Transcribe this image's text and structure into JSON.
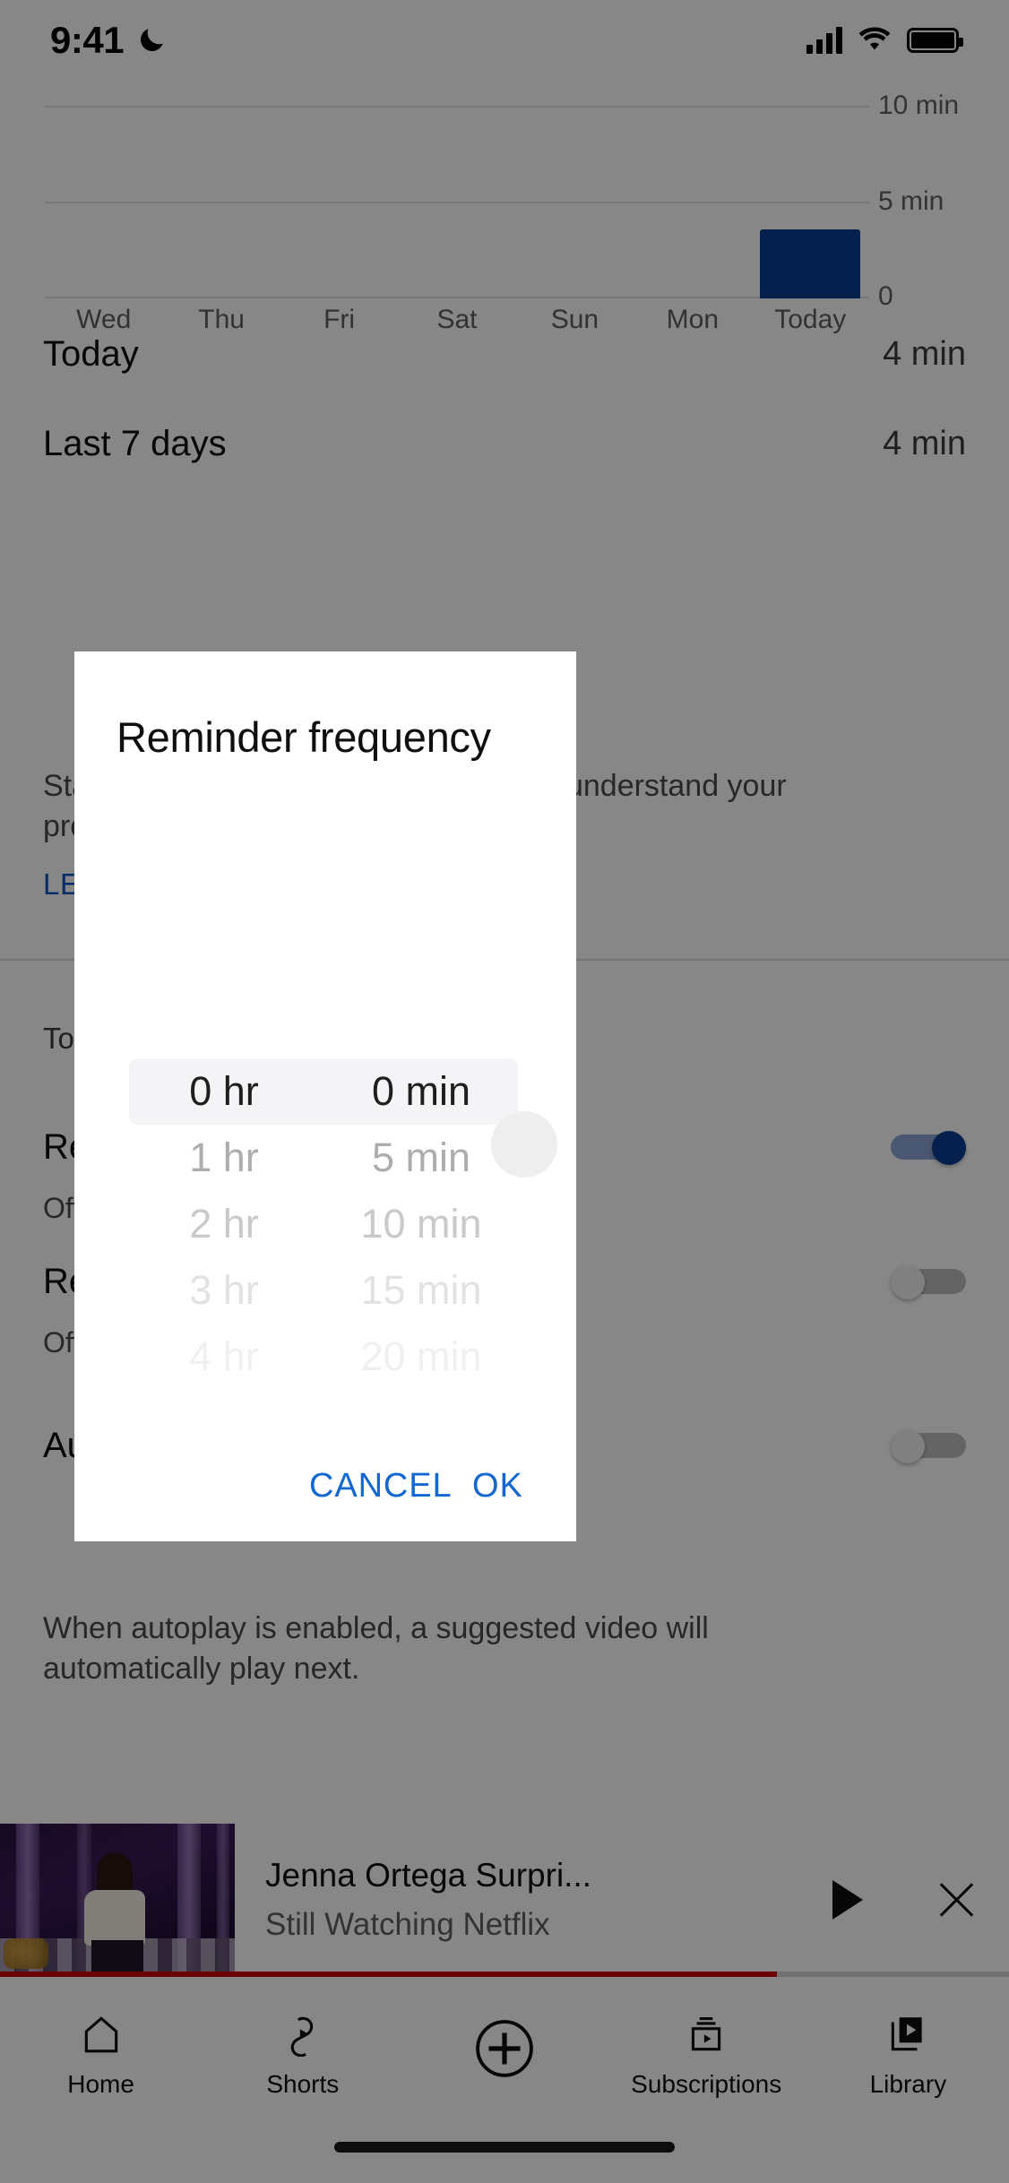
{
  "status_bar": {
    "time": "9:41",
    "dnd_icon": "crescent-moon-icon",
    "signal_icon": "cellular-signal-icon",
    "wifi_icon": "wifi-icon",
    "battery_icon": "battery-full-icon"
  },
  "chart_data": {
    "type": "bar",
    "title": "",
    "categories": [
      "Wed",
      "Thu",
      "Fri",
      "Sat",
      "Sun",
      "Mon",
      "Today"
    ],
    "values": [
      0,
      0,
      0,
      0,
      0,
      0,
      4
    ],
    "xlabel": "",
    "ylabel": "",
    "ylim": [
      0,
      11
    ],
    "ytick_labels": [
      "10 min",
      "5 min",
      "0"
    ],
    "ytick_values": [
      10,
      5,
      0
    ],
    "grid": true,
    "legend": "none",
    "bar_color": "#0b3d91",
    "unit": "min"
  },
  "stats": {
    "today_label": "Today",
    "today_value": "4 min",
    "last7_label": "Last 7 days",
    "last7_value": "4 min",
    "description_line1": "Stats on your watch time can help you understand your",
    "description_line2": "productivity and habits.",
    "learn_more": "LEARN MORE"
  },
  "tools": {
    "section_label": "Tools",
    "items": [
      {
        "title": "Remind me to take a break",
        "subtitle": "Off",
        "toggle": "on"
      },
      {
        "title": "Remind me when it's bedtime",
        "subtitle": "Off",
        "toggle": "off"
      }
    ],
    "autoplay": {
      "title": "Autoplay on mobile/tablet",
      "toggle": "off",
      "description_line1": "When autoplay is enabled, a suggested video will",
      "description_line2": "automatically play next."
    }
  },
  "dialog": {
    "title": "Reminder frequency",
    "hours": [
      {
        "label": "0 hr",
        "state": "selected"
      },
      {
        "label": "1 hr",
        "state": "o1"
      },
      {
        "label": "2 hr",
        "state": "o2"
      },
      {
        "label": "3 hr",
        "state": "o3"
      },
      {
        "label": "4 hr",
        "state": "o4"
      }
    ],
    "minutes": [
      {
        "label": "0 min",
        "state": "selected"
      },
      {
        "label": "5 min",
        "state": "o1"
      },
      {
        "label": "10 min",
        "state": "o2"
      },
      {
        "label": "15 min",
        "state": "o3"
      },
      {
        "label": "20 min",
        "state": "o4"
      }
    ],
    "cancel_label": "CANCEL",
    "ok_label": "OK",
    "accent_color": "#1367d0"
  },
  "miniplayer": {
    "title": "Jenna Ortega Surpri...",
    "channel": "Still Watching Netflix",
    "play_icon": "play-icon",
    "close_icon": "close-icon",
    "progress_percent": 77,
    "progress_color": "#cc0000"
  },
  "bottom_nav": {
    "items": [
      {
        "label": "Home",
        "icon": "home-icon"
      },
      {
        "label": "Shorts",
        "icon": "shorts-icon"
      },
      {
        "label": "",
        "icon": "create-plus-icon"
      },
      {
        "label": "Subscriptions",
        "icon": "subscriptions-icon"
      },
      {
        "label": "Library",
        "icon": "library-icon"
      }
    ]
  }
}
